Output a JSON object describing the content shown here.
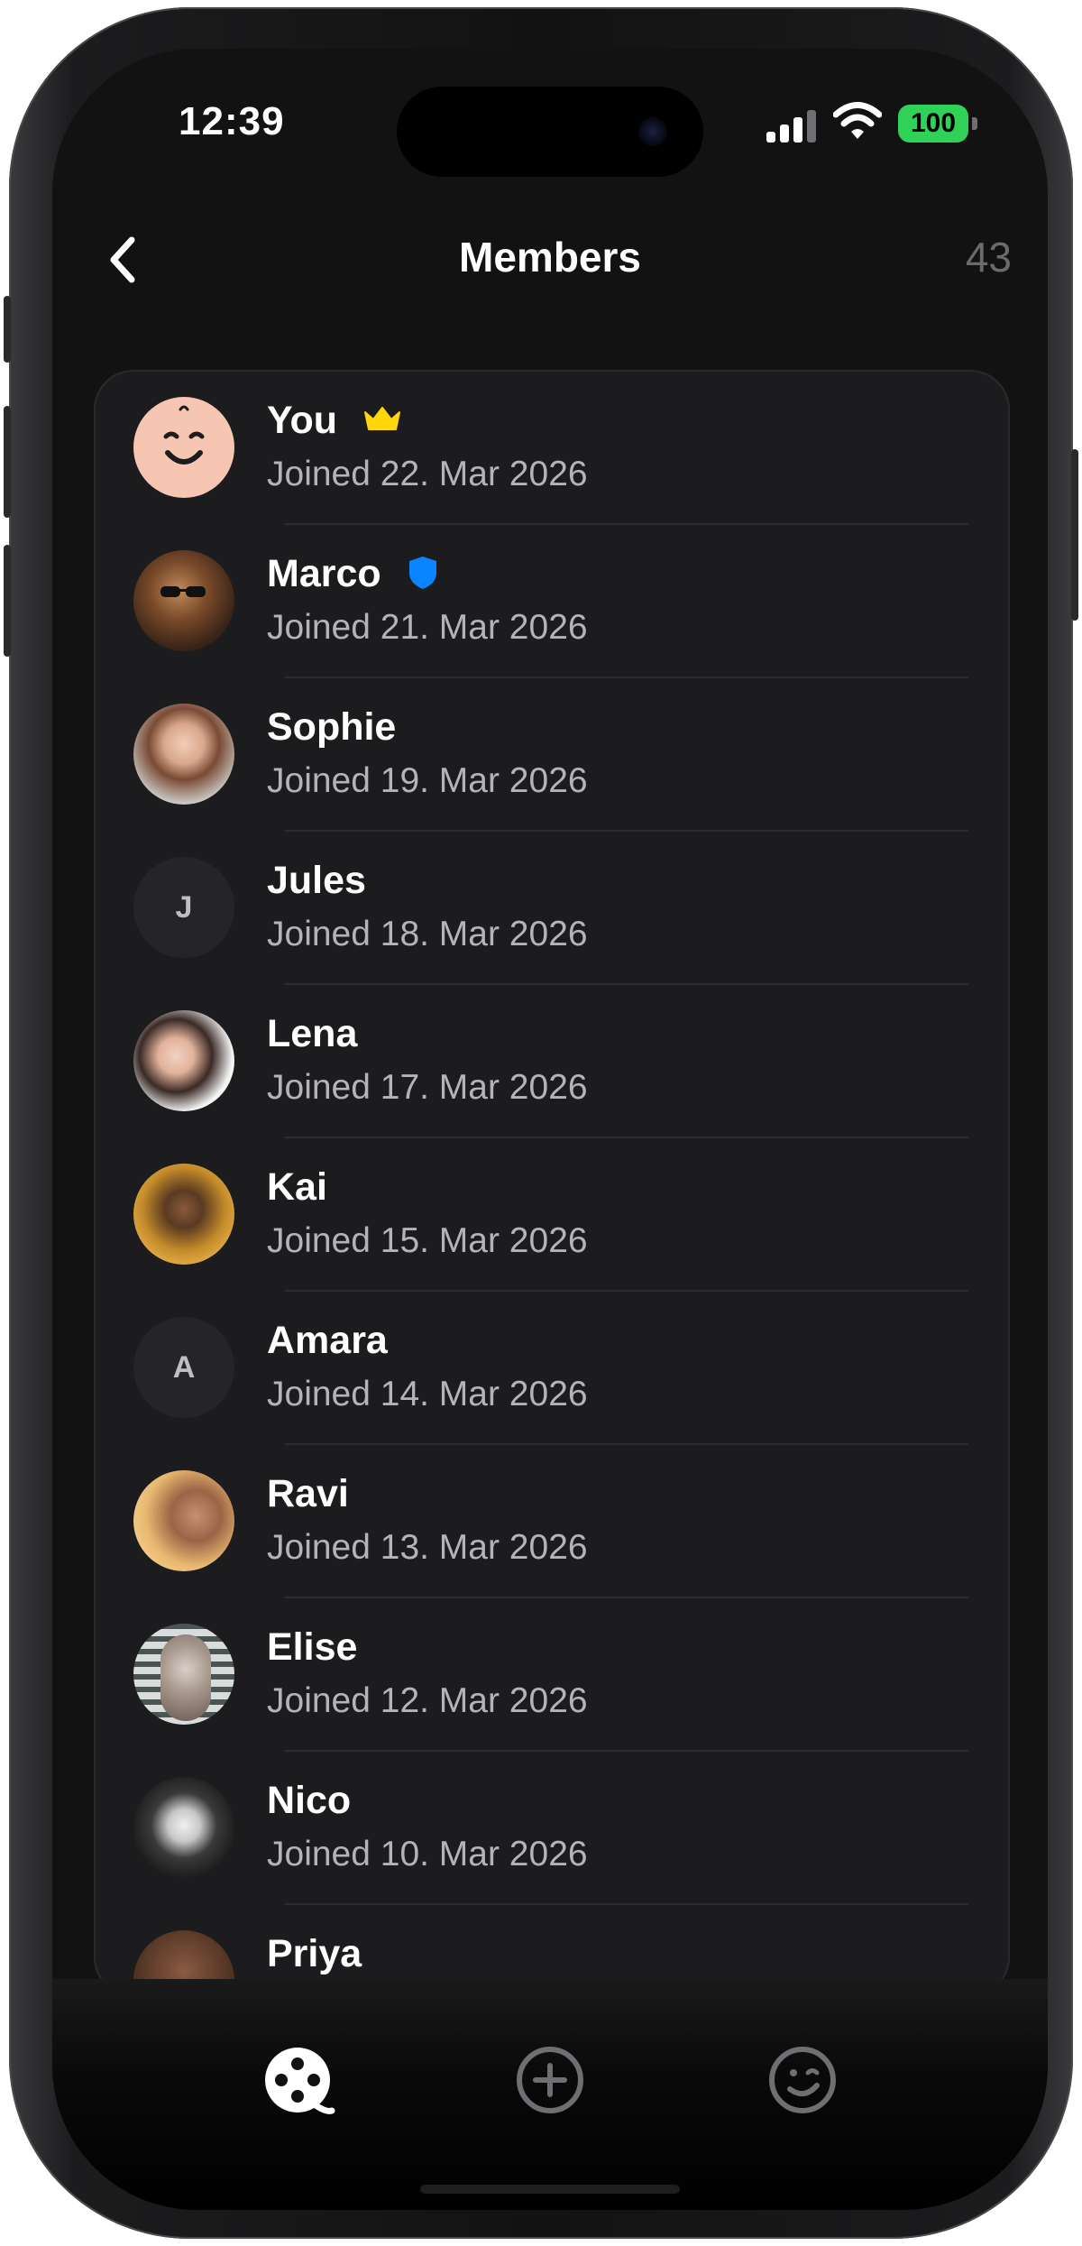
{
  "status_bar": {
    "time": "12:39",
    "battery": "100",
    "battery_color": "#30d158"
  },
  "header": {
    "back_icon": "chevron-left-icon",
    "title": "Members",
    "count": "43"
  },
  "members": [
    {
      "name": "You",
      "joined": "Joined 22. Mar 2026",
      "badge": "crown-icon",
      "avatar": "smiley-face"
    },
    {
      "name": "Marco",
      "joined": "Joined 21. Mar 2026",
      "badge": "shield-icon",
      "avatar": "photo"
    },
    {
      "name": "Sophie",
      "joined": "Joined 19. Mar 2026",
      "avatar": "photo"
    },
    {
      "name": "Jules",
      "joined": "Joined 18. Mar 2026",
      "initial": "J"
    },
    {
      "name": "Lena",
      "joined": "Joined 17. Mar 2026",
      "avatar": "photo"
    },
    {
      "name": "Kai",
      "joined": "Joined 15. Mar 2026",
      "avatar": "photo"
    },
    {
      "name": "Amara",
      "joined": "Joined 14. Mar 2026",
      "initial": "A"
    },
    {
      "name": "Ravi",
      "joined": "Joined 13. Mar 2026",
      "avatar": "photo"
    },
    {
      "name": "Elise",
      "joined": "Joined 12. Mar 2026",
      "avatar": "photo"
    },
    {
      "name": "Nico",
      "joined": "Joined 10. Mar 2026",
      "avatar": "photo"
    },
    {
      "name": "Priya",
      "joined": "",
      "avatar": "photo"
    }
  ],
  "tab_bar": {
    "tabs": [
      "film-reel-icon",
      "add-circle-icon",
      "smiley-icon"
    ],
    "active_color": "#ffffff",
    "inactive_color": "#6e6e73"
  },
  "colors": {
    "background": "#121212",
    "card": "#1c1c1e",
    "crown": "#ffd60a",
    "shield": "#0a84ff"
  }
}
